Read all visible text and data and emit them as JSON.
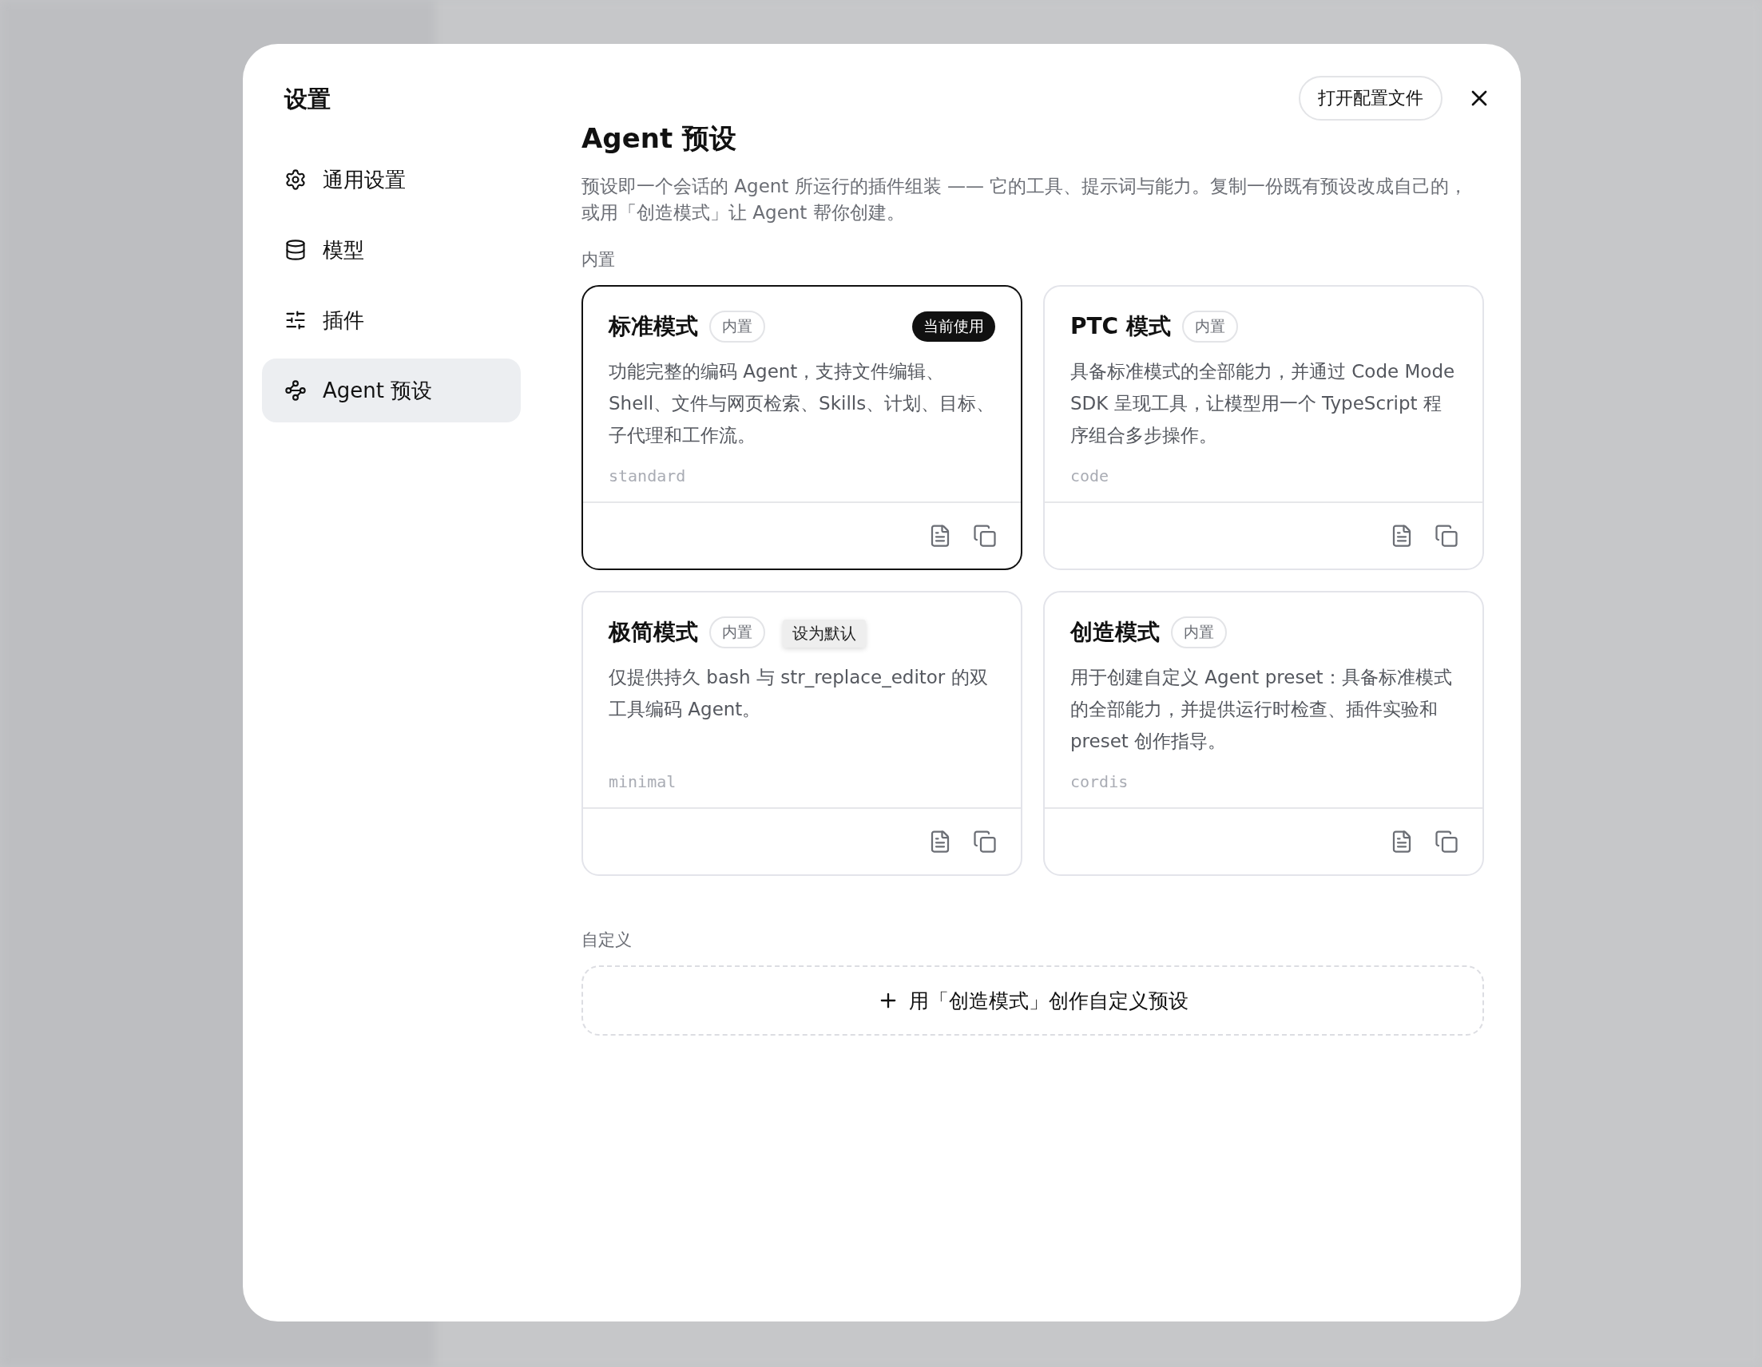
{
  "dialog": {
    "title": "设置",
    "open_config_button": "打开配置文件"
  },
  "nav": [
    {
      "label": "通用设置",
      "selected": false
    },
    {
      "label": "模型",
      "selected": false
    },
    {
      "label": "插件",
      "selected": false
    },
    {
      "label": "Agent 预设",
      "selected": true
    }
  ],
  "page": {
    "title": "Agent 预设",
    "description": "预设即一个会话的 Agent 所运行的插件组装 —— 它的工具、提示词与能力。复制一份既有预设改成自己的，或用「创造模式」让 Agent 帮你创建。"
  },
  "builtin_section": {
    "label": "内置"
  },
  "presets": [
    {
      "name": "标准模式",
      "badge": "内置",
      "current": true,
      "current_label": "当前使用",
      "description": "功能完整的编码 Agent，支持文件编辑、Shell、文件与网页检索、Skills、计划、目标、子代理和工作流。",
      "id": "standard"
    },
    {
      "name": "PTC 模式",
      "badge": "内置",
      "current": false,
      "description": "具备标准模式的全部能力，并通过 Code Mode SDK 呈现工具，让模型用一个 TypeScript 程序组合多步操作。",
      "id": "code"
    },
    {
      "name": "极简模式",
      "badge": "内置",
      "current": false,
      "tooltip": "设为默认",
      "description": "仅提供持久 bash 与 str_replace_editor 的双工具编码 Agent。",
      "id": "minimal"
    },
    {
      "name": "创造模式",
      "badge": "内置",
      "current": false,
      "description": "用于创建自定义 Agent preset：具备标准模式的全部能力，并提供运行时检查、插件实验和 preset 创作指导。",
      "id": "cordis"
    }
  ],
  "custom_section": {
    "label": "自定义",
    "create_button": "用「创造模式」创作自定义预设"
  }
}
